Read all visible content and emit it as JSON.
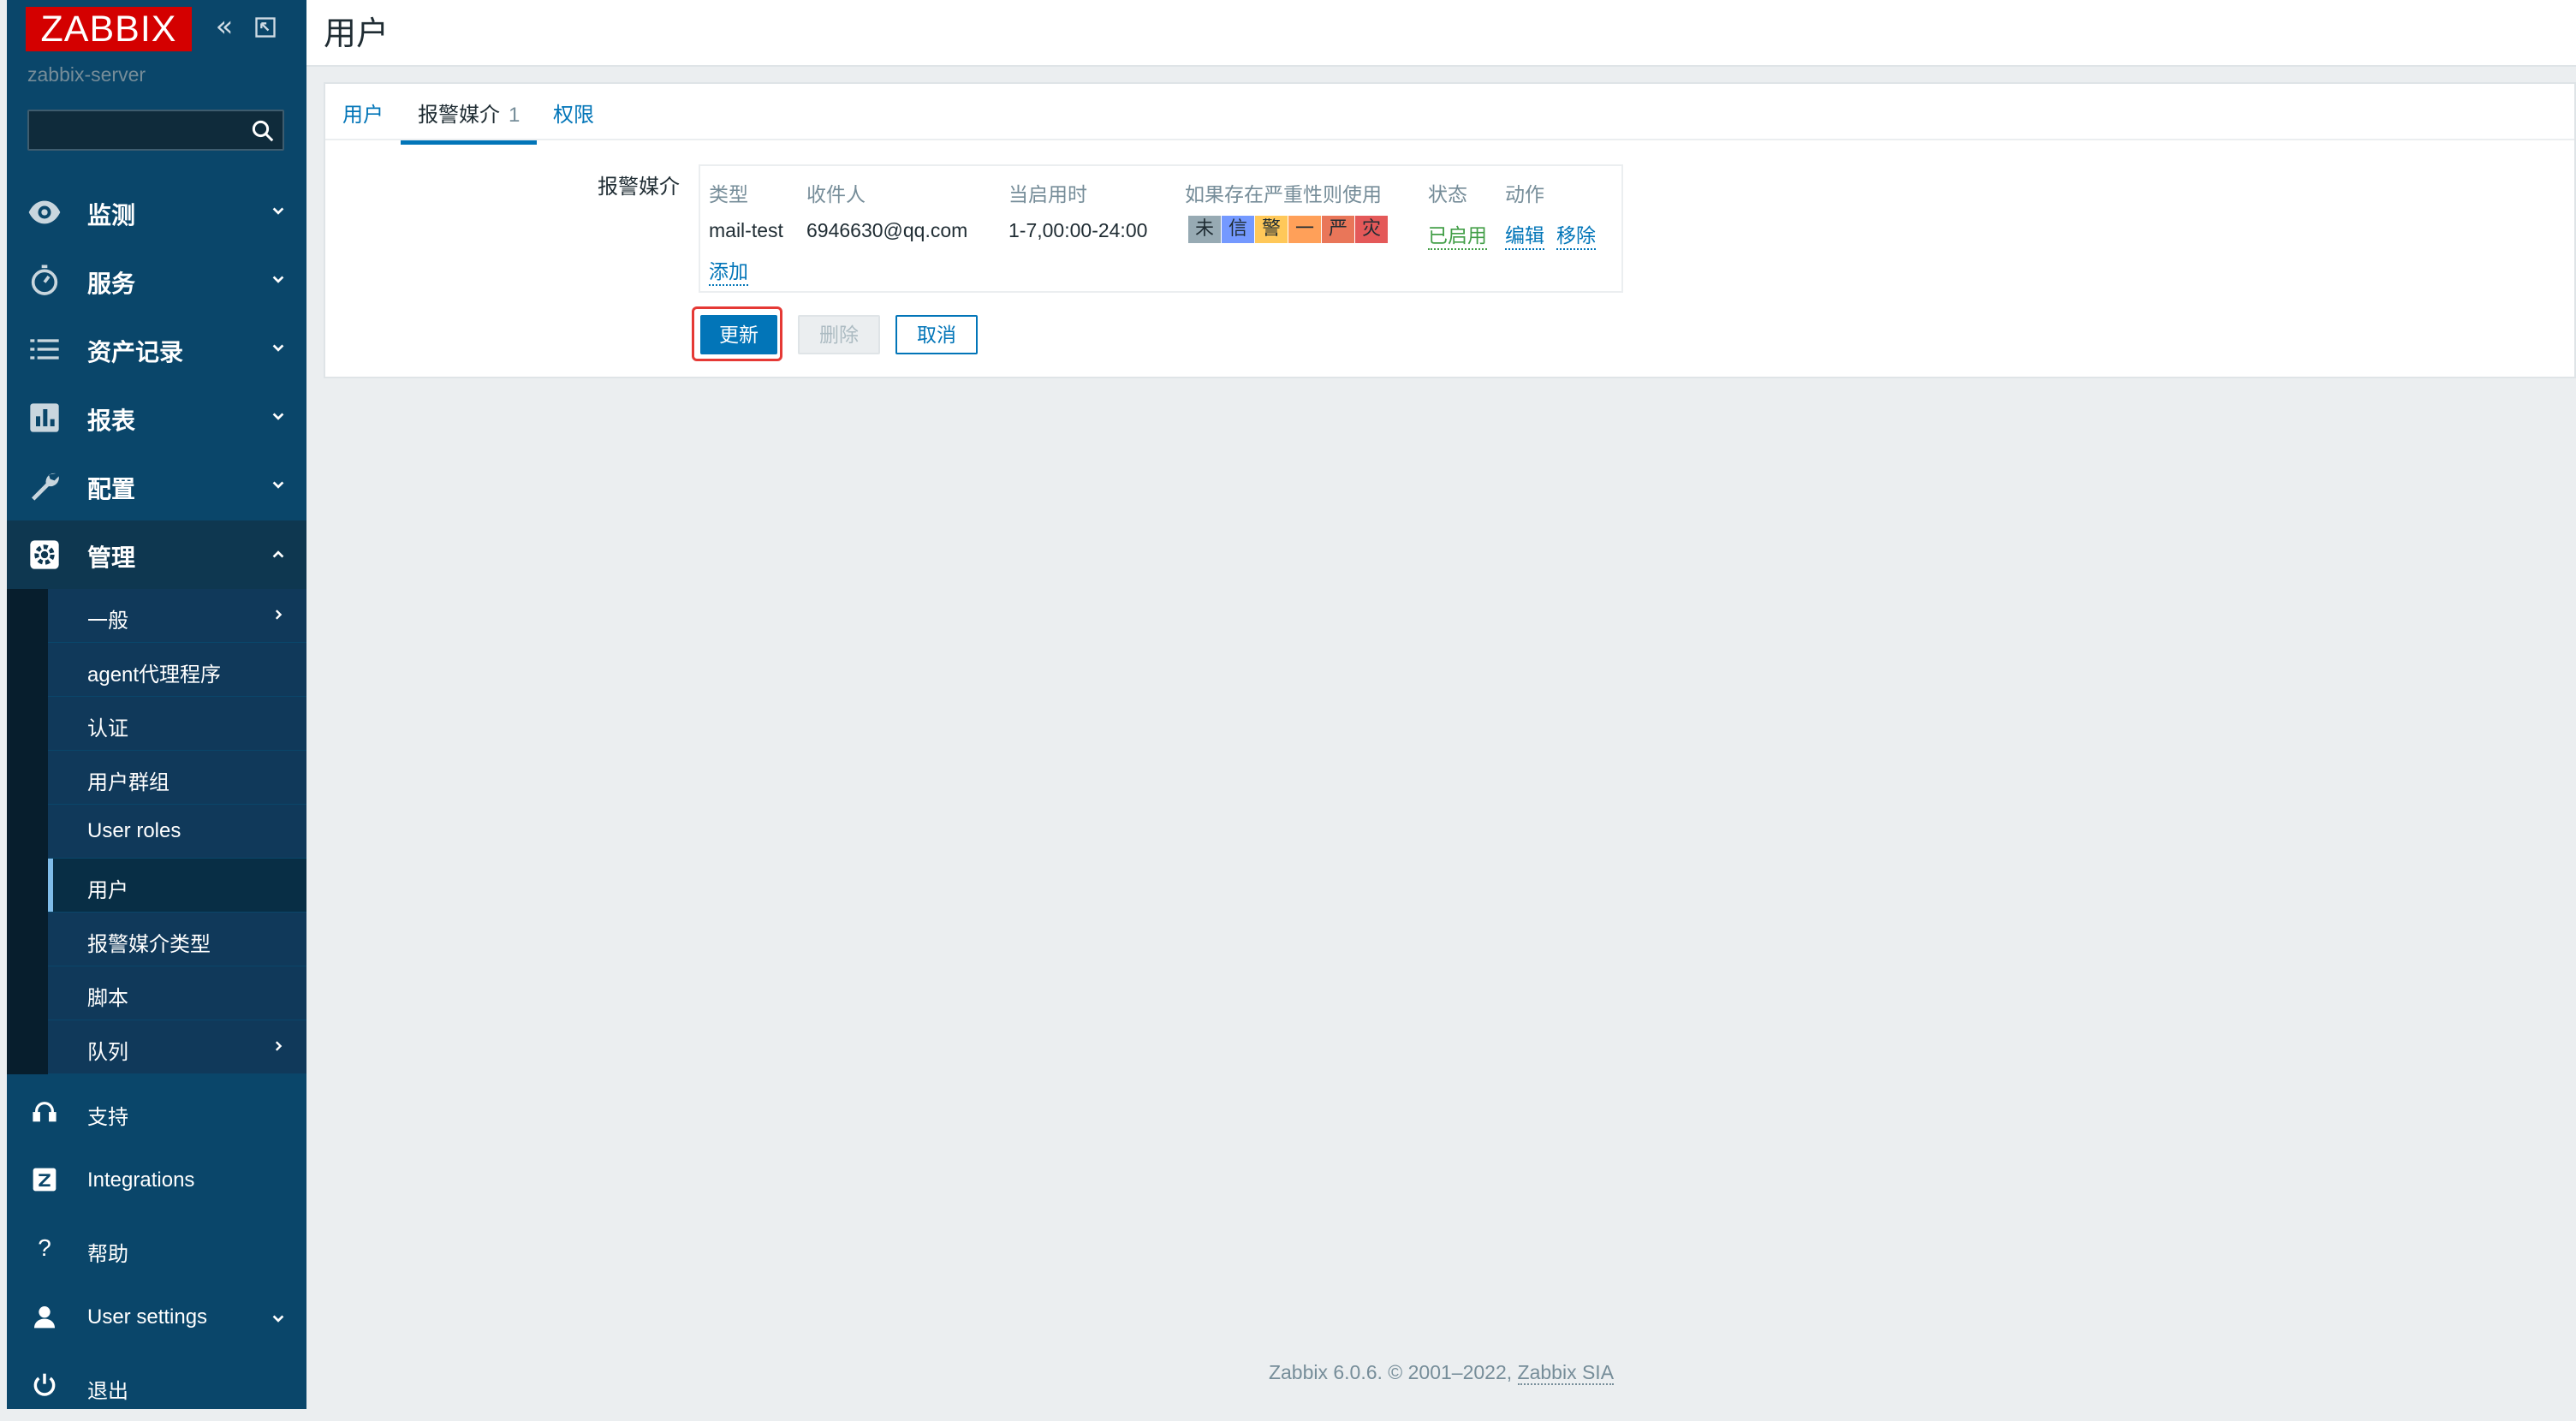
{
  "sidebar": {
    "logo": "ZABBIX",
    "server_name": "zabbix-server",
    "search": {
      "placeholder": "",
      "value": ""
    },
    "menu": [
      {
        "label": "监测",
        "icon": "eye-icon"
      },
      {
        "label": "服务",
        "icon": "stopwatch-icon"
      },
      {
        "label": "资产记录",
        "icon": "list-icon"
      },
      {
        "label": "报表",
        "icon": "bar-chart-icon"
      },
      {
        "label": "配置",
        "icon": "wrench-icon"
      },
      {
        "label": "管理",
        "icon": "gear-icon"
      }
    ],
    "admin_submenu": [
      {
        "label": "一般"
      },
      {
        "label": "agent代理程序"
      },
      {
        "label": "认证"
      },
      {
        "label": "用户群组"
      },
      {
        "label": "User roles"
      },
      {
        "label": "用户"
      },
      {
        "label": "报警媒介类型"
      },
      {
        "label": "脚本"
      },
      {
        "label": "队列"
      }
    ],
    "bottom": [
      {
        "label": "支持",
        "icon": "headset-icon"
      },
      {
        "label": "Integrations",
        "icon": "zabbix-z-icon"
      },
      {
        "label": "帮助",
        "icon": "help-icon"
      },
      {
        "label": "User settings",
        "icon": "user-icon"
      },
      {
        "label": "退出",
        "icon": "power-icon"
      }
    ]
  },
  "header": {
    "title": "用户"
  },
  "tabs": [
    {
      "label": "用户"
    },
    {
      "label": "报警媒介",
      "count": "1"
    },
    {
      "label": "权限"
    }
  ],
  "media": {
    "field_label": "报警媒介",
    "columns": [
      "类型",
      "收件人",
      "当启用时",
      "如果存在严重性则使用",
      "状态",
      "动作"
    ],
    "row": {
      "type": "mail-test",
      "recipient": "6946630@qq.com",
      "when_active": "1-7,00:00-24:00",
      "severities": [
        {
          "label": "未",
          "color": "#97aab3"
        },
        {
          "label": "信",
          "color": "#7499ff"
        },
        {
          "label": "警",
          "color": "#ffc859"
        },
        {
          "label": "一",
          "color": "#ffa059"
        },
        {
          "label": "严",
          "color": "#e97659"
        },
        {
          "label": "灾",
          "color": "#e45959"
        }
      ],
      "status": "已启用",
      "action_edit": "编辑",
      "action_remove": "移除"
    },
    "add_label": "添加"
  },
  "buttons": {
    "update": "更新",
    "delete": "删除",
    "cancel": "取消"
  },
  "footer": {
    "text": "Zabbix 6.0.6. © 2001–2022, ",
    "company": "Zabbix SIA"
  }
}
